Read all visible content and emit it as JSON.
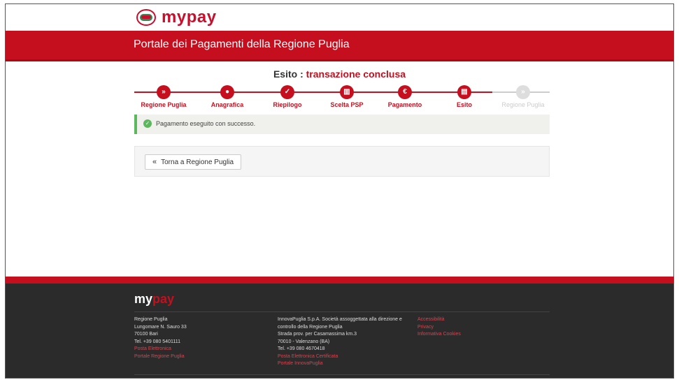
{
  "header": {
    "brand_my": "my",
    "brand_pay": "pay",
    "portal_title": "Portale dei Pagamenti della Regione Puglia"
  },
  "result": {
    "label": "Esito :",
    "status": "transazione conclusa"
  },
  "steps": [
    {
      "label": "Regione Puglia",
      "icon": "»",
      "icon_name": "chevron-double-right-icon",
      "state": "done"
    },
    {
      "label": "Anagrafica",
      "icon": "●",
      "icon_name": "user-icon",
      "state": "done"
    },
    {
      "label": "Riepilogo",
      "icon": "✓",
      "icon_name": "check-icon",
      "state": "done"
    },
    {
      "label": "Scelta PSP",
      "icon": "▥",
      "icon_name": "bank-icon",
      "state": "done"
    },
    {
      "label": "Pagamento",
      "icon": "€",
      "icon_name": "euro-icon",
      "state": "done"
    },
    {
      "label": "Esito",
      "icon": "▤",
      "icon_name": "document-icon",
      "state": "done"
    },
    {
      "label": "Regione Puglia",
      "icon": "»",
      "icon_name": "chevron-right-icon",
      "state": "disabled"
    }
  ],
  "alert": {
    "message": "Pagamento eseguito con successo.",
    "icon": "✓"
  },
  "back_button": {
    "chevron": "«",
    "label": "Torna a Regione Puglia"
  },
  "footer": {
    "logo_my": "my",
    "logo_pay": "pay",
    "col1": {
      "lines": [
        "Regione Puglia",
        "Lungomare N. Sauro 33",
        "70100 Bari",
        "Tel. +39 080 5401111"
      ],
      "links": [
        "Posta Elettronica",
        "Portale Regione Puglia"
      ]
    },
    "col2": {
      "lines": [
        "InnovaPuglia S.p.A. Società assoggettata alla direzione e",
        "controllo della Regione Puglia",
        "Strada prov. per Casamassima km.3",
        "70010 - Valenzano (BA)",
        "Tel. +39 080 4670418"
      ],
      "links": [
        "Posta Elettronica Certificata",
        "Portale InnovaPuglia"
      ]
    },
    "col3": {
      "links": [
        "Accessibilità",
        "Privacy",
        "Informativa Cookies"
      ]
    }
  },
  "colors": {
    "brand_red": "#c50f1f",
    "success_green": "#5cb85c",
    "footer_bg": "#2b2b2b"
  }
}
